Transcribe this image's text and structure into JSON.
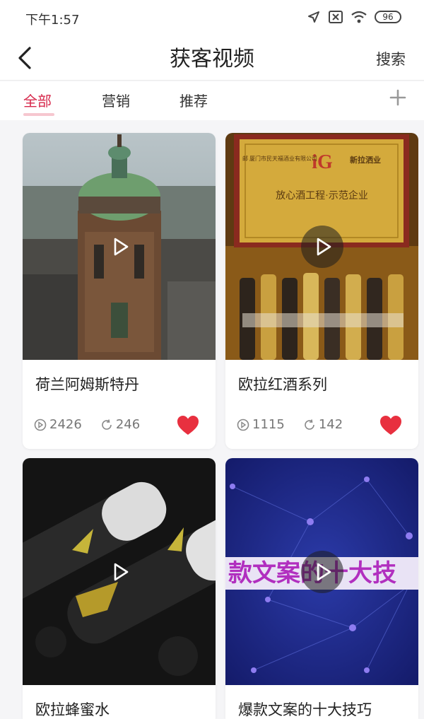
{
  "status_bar": {
    "time": "下午1:57",
    "battery": "96"
  },
  "header": {
    "title": "获客视频",
    "search_label": "搜索"
  },
  "tabs": [
    {
      "label": "全部",
      "active": true
    },
    {
      "label": "营销",
      "active": false
    },
    {
      "label": "推荐",
      "active": false
    }
  ],
  "colors": {
    "accent": "#d6274a",
    "heart": "#e8303f"
  },
  "videos": [
    {
      "title": "荷兰阿姆斯特丹",
      "views": "2426",
      "shares": "246",
      "liked": true
    },
    {
      "title": "欧拉红酒系列",
      "views": "1115",
      "shares": "142",
      "liked": true,
      "plaque": {
        "header": "邮 厦门市民天福酒业有限公司",
        "brand": "新拉洒业",
        "headline": "放心酒工程·示范企业"
      }
    },
    {
      "title": "欧拉蜂蜜水"
    },
    {
      "title": "爆款文案的十大技巧",
      "overlay_text": "款文案的十大技"
    }
  ]
}
